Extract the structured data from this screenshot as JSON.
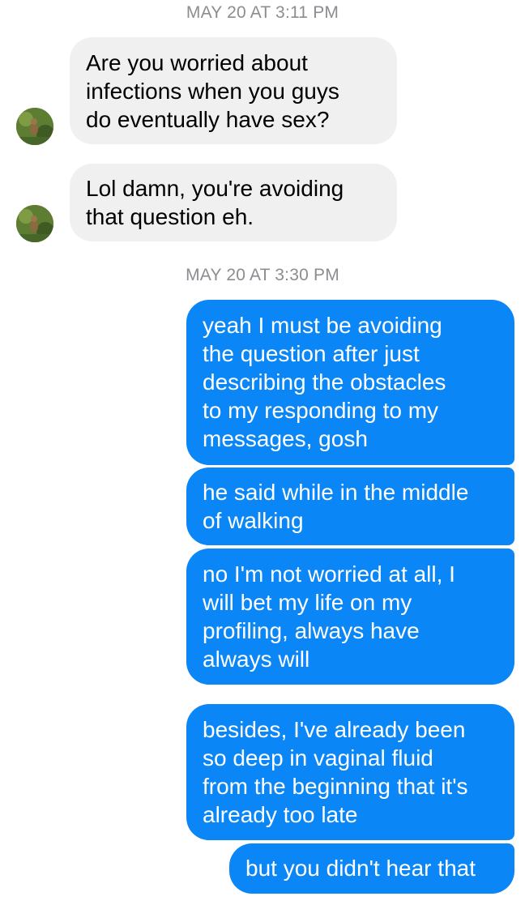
{
  "timestamps": {
    "first": "MAY 20 AT 3:11 PM",
    "second": "MAY 20 AT 3:30 PM"
  },
  "messages": {
    "incoming": [
      "Are you worried about\ninfections when you guys\ndo eventually have sex?",
      "Lol damn, you're avoiding\nthat question eh."
    ],
    "outgoing": [
      "yeah I must be avoiding\nthe question after just\ndescribing the obstacles\nto my responding to my\nmessages, gosh",
      "he said while in the middle\nof walking",
      "no I'm not worried at all, I\nwill bet my life on my\nprofiling, always have\nalways will",
      "besides, I've already been\nso deep in vaginal fluid\nfrom the beginning that it's\nalready too late",
      "but you didn't hear that"
    ]
  },
  "colors": {
    "outgoing_bubble": "#0a86f7",
    "incoming_bubble": "#f0f0f0",
    "timestamp_text": "#8a8d91"
  },
  "icons": {
    "avatar": "contact-avatar-photo"
  }
}
